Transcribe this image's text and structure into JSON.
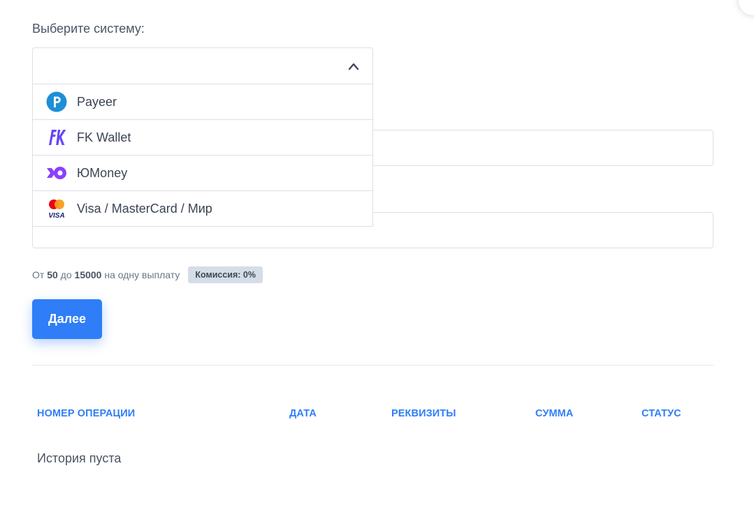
{
  "form": {
    "select_label": "Выберите систему:",
    "select_value": "",
    "options": [
      {
        "label": "Payeer",
        "icon": "payeer-icon"
      },
      {
        "label": "FK Wallet",
        "icon": "fk-wallet-icon"
      },
      {
        "label": "ЮMoney",
        "icon": "yoomoney-icon"
      },
      {
        "label": "Visa / MasterCard / Мир",
        "icon": "cards-icon"
      }
    ],
    "limits": {
      "prefix": "От",
      "min": "50",
      "mid": "до",
      "max": "15000",
      "suffix": "на одну выплату"
    },
    "commission_badge": "Комиссия: 0%",
    "next_button": "Далее"
  },
  "history": {
    "columns": [
      "НОМЕР ОПЕРАЦИИ",
      "ДАТА",
      "РЕКВИЗИТЫ",
      "СУММА",
      "СТАТУС"
    ],
    "empty_text": "История пуста"
  },
  "colors": {
    "accent": "#2f7ef7",
    "badge_bg": "#d5dde7",
    "border": "#dcdfe6"
  }
}
